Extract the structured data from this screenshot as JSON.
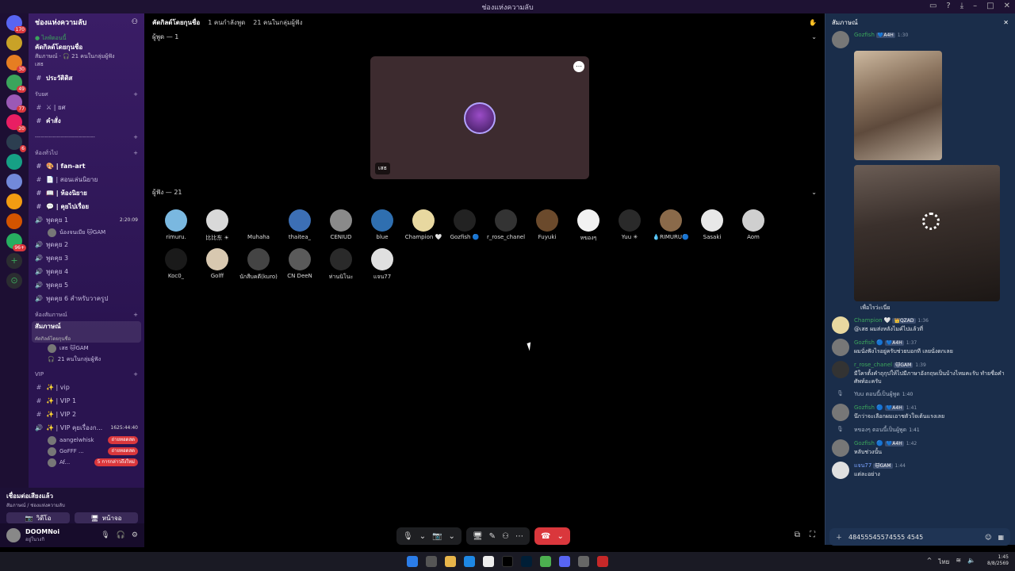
{
  "window": {
    "title": "ช่องแห่งความลับ"
  },
  "servers": [
    {
      "badge": "170",
      "color": "#5865f2"
    },
    {
      "badge": "",
      "color": "#c9a227"
    },
    {
      "badge": "30",
      "color": "#e67e22"
    },
    {
      "badge": "49",
      "color": "#3ba55c"
    },
    {
      "badge": "77",
      "color": "#9b59b6"
    },
    {
      "badge": "20",
      "color": "#e91e63"
    },
    {
      "badge": "6",
      "color": "#2c3e50"
    },
    {
      "badge": "",
      "color": "#16a085"
    },
    {
      "badge": "",
      "color": "#7289da"
    },
    {
      "badge": "",
      "color": "#f39c12"
    },
    {
      "badge": "",
      "color": "#d35400"
    },
    {
      "badge": "96+",
      "color": "#27ae60"
    }
  ],
  "guild": {
    "name": "ช่องแห่งความลับ"
  },
  "event": {
    "tag": "● ไลฟ์ตอนนี้",
    "title": "คัดกิลด์โดยกุนชื่อ",
    "meta": "สัมภาษณ์ · 🎧 21 คนในกลุ่มผู้ฟัง",
    "host": "เสธ"
  },
  "channels": {
    "top": [
      {
        "icon": "#",
        "label": "ประวัติดิส"
      }
    ],
    "cat_rank": "รับยศ",
    "rank": [
      {
        "label": "⚔ | ยศ"
      },
      {
        "label": "คำสั่ง"
      }
    ],
    "divider": "------------------------------",
    "cat_chat": "ห้องทั่วไป",
    "chat": [
      {
        "label": "🎨 | fan-art"
      },
      {
        "label": "📄 | สอนเล่นนิยาย"
      },
      {
        "label": "📖 | ห้องนิยาย"
      },
      {
        "label": "💬 | คุยไปเรื่อย"
      }
    ],
    "voice1": {
      "label": "พูดคุย 1",
      "timer": "2:20:09"
    },
    "voice1_user": "น้องจนเมีย 🐱GAM",
    "voices": [
      "พูดคุย 2",
      "พูดคุย 3",
      "พูดคุย 4",
      "พูดคุย 5",
      "พูดคุย 6 สำหรับวาครูป"
    ],
    "cat_interview": "ห้องสัมภาษณ์",
    "active": {
      "label": "สัมภาษณ์",
      "sub": "คัดกิลด์โดยกุนชื่อ"
    },
    "active_users": [
      "เสธ 🐱GAM",
      "21 คนในกลุ่มผู้ฟัง"
    ],
    "cat_vip": "VIP",
    "vip": [
      "✨ | vip",
      "✨ | VIP 1",
      "✨ | VIP 2"
    ],
    "vip_voice": {
      "label": "✨ | VIP คุยเรื่องก...",
      "timer": "1625:44:40"
    },
    "vip_users": [
      {
        "name": "aangelwhisk",
        "pill": "ถ่ายทอดสด"
      },
      {
        "name": "GoFFF ...",
        "pill": "ถ่ายทอดสด"
      },
      {
        "name": "Af...",
        "pill": "5 การกล่าวถึงใหม่"
      }
    ]
  },
  "voice_status": {
    "title": "เชื่อมต่อเสียงแล้ว",
    "sub": "สัมภาษณ์ / ช่องแห่งความลับ",
    "video": "วิดีโอ",
    "screen": "หน้าจอ"
  },
  "user": {
    "name": "DOOMNoi",
    "status": "อยู่ในวงกิ"
  },
  "main": {
    "title": "คัดกิลด์โดยกุนชื่อ",
    "speaking": "1 คนกำลังพูด",
    "audience": "21 คนในกลุ่มผู้ฟัง",
    "speakers_label": "ผู้พูด — 1",
    "listeners_label": "ผู้ฟัง — 21",
    "stage_name": "เสธ"
  },
  "listeners": [
    {
      "name": "rimuru.",
      "color": "#7ab8e0"
    },
    {
      "name": "比比东 ☀",
      "color": "#d9d9d9"
    },
    {
      "name": "Muhaha",
      "color": "#000000"
    },
    {
      "name": "thaitea_",
      "color": "#3c6fb5"
    },
    {
      "name": "CENIUD",
      "color": "#8a8a8a"
    },
    {
      "name": "blue",
      "color": "#2f6fb0"
    },
    {
      "name": "Champion 🤍",
      "color": "#e8d8a0"
    },
    {
      "name": "Gozfish 🔵",
      "color": "#222222"
    },
    {
      "name": "r_rose_chanel",
      "color": "#333333"
    },
    {
      "name": "Fuyuki",
      "color": "#6b4a2c"
    },
    {
      "name": "หของๆ",
      "color": "#f2f2f2"
    },
    {
      "name": "Yuu ✳",
      "color": "#2a2a2a"
    },
    {
      "name": "💧RIMURU🔵",
      "color": "#8a6a4a"
    },
    {
      "name": "Sasaki",
      "color": "#e8e8e8"
    },
    {
      "name": "Aom",
      "color": "#cfcfcf"
    },
    {
      "name": "Koc0_",
      "color": "#1a1a1a"
    },
    {
      "name": "Golff",
      "color": "#d8c8b0"
    },
    {
      "name": "นักสืบคดี(kuro)",
      "color": "#444444"
    },
    {
      "name": "CN DeeN",
      "color": "#5a5a5a"
    },
    {
      "name": "ท่านนิโนะ",
      "color": "#2a2a2a"
    },
    {
      "name": "แจน77",
      "color": "#e0e0e0"
    }
  ],
  "chat": {
    "title": "สัมภาษณ์",
    "first": {
      "who": "Gozfish",
      "tag": "💙A4H",
      "time": "1:30",
      "color": "#3ba55c"
    },
    "caption": "เพื่อไรว่ะเนี่ย",
    "messages": [
      {
        "who": "Champion 🤍",
        "tag": "👑QZAD",
        "time": "1:36",
        "text": "@เสธ ผมส่งหลังไมค์ไปแล้วที่",
        "color": "#3ba55c",
        "avatar": "#e8d8a0"
      },
      {
        "who": "Gozfish 🔵",
        "tag": "💙A4H",
        "time": "1:37",
        "text": "ผมนั่งฟังไรอยู่ครับช่วยบอกที เลยนั่งดกเลย",
        "color": "#3ba55c",
        "avatar": "#777777"
      },
      {
        "who": "r_rose_chanel",
        "tag": "🐱GAM",
        "time": "1:39",
        "text": "มีใครตั้งคำถุกุปให้ไปมีภาษาอังกฤษเป็นบ้างไหมคะรับ ทำยชื่อคำศัพท์อะครับ",
        "color": "#3ba55c",
        "avatar": "#333333"
      },
      {
        "sys": true,
        "text": "Yuu ตอนนี้เป็นผู้พูด",
        "time": "1:40"
      },
      {
        "who": "Gozfish 🔵",
        "tag": "💙A4H",
        "time": "1:41",
        "text": "นึกว่าจะเลือกผมเอาชตัวใจเต้นแรงเลย",
        "color": "#3ba55c",
        "avatar": "#777777"
      },
      {
        "sys": true,
        "text": "หของๆ ตอนนี้เป็นผู้พูด",
        "time": "1:41"
      },
      {
        "who": "Gozfish 🔵",
        "tag": "💙A4H",
        "time": "1:42",
        "text": "หลับช่วงนั้น",
        "color": "#3ba55c",
        "avatar": "#777777"
      },
      {
        "who": "แจน77",
        "tag": "🐱GAM",
        "time": "1:44",
        "text": "แต่ละอย่าง",
        "color": "#7aa2ff",
        "avatar": "#e0e0e0"
      }
    ],
    "input_value": "48455545574555 4545"
  },
  "clock": {
    "time": "1:45",
    "date": "8/8/2569",
    "lang": "ไทย"
  }
}
